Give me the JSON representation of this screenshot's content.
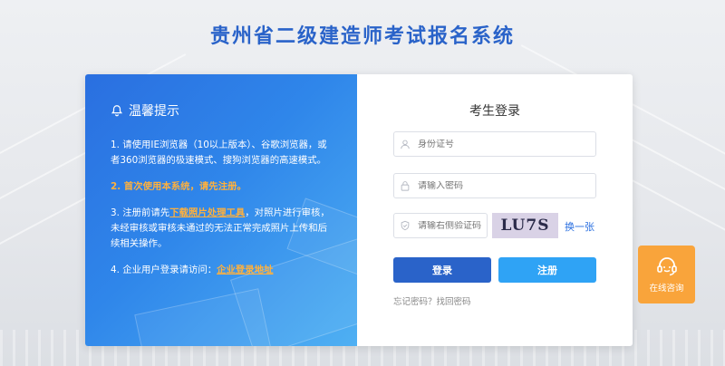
{
  "header": {
    "title": "贵州省二级建造师考试报名系统"
  },
  "notice": {
    "title": "温馨提示",
    "items": [
      {
        "text": "1. 请使用IE浏览器（10以上版本）、谷歌浏览器，或者360浏览器的极速模式、搜狗浏览器的高速模式。"
      },
      {
        "text": "2. 首次使用本系统，请先注册。"
      },
      {
        "prefix": "3. 注册前请先",
        "link": "下载照片处理工具",
        "suffix": "，对照片进行审核，未经审核或审核未通过的无法正常完成照片上传和后续相关操作。"
      },
      {
        "prefix": "4. 企业用户登录请访问：",
        "link": "企业登录地址"
      }
    ]
  },
  "login": {
    "title": "考生登录",
    "id_placeholder": "身份证号",
    "password_placeholder": "请输入密码",
    "captcha_placeholder": "请输右侧验证码",
    "captcha_text": "LU7S",
    "refresh_label": "换一张",
    "login_label": "登录",
    "register_label": "注册",
    "forgot_label": "忘记密码？找回密码"
  },
  "consult": {
    "label": "在线咨询"
  },
  "colors": {
    "primary": "#2a63c9",
    "register": "#2fa3f5",
    "highlight": "#ffb13d",
    "consult": "#f9a43b"
  }
}
